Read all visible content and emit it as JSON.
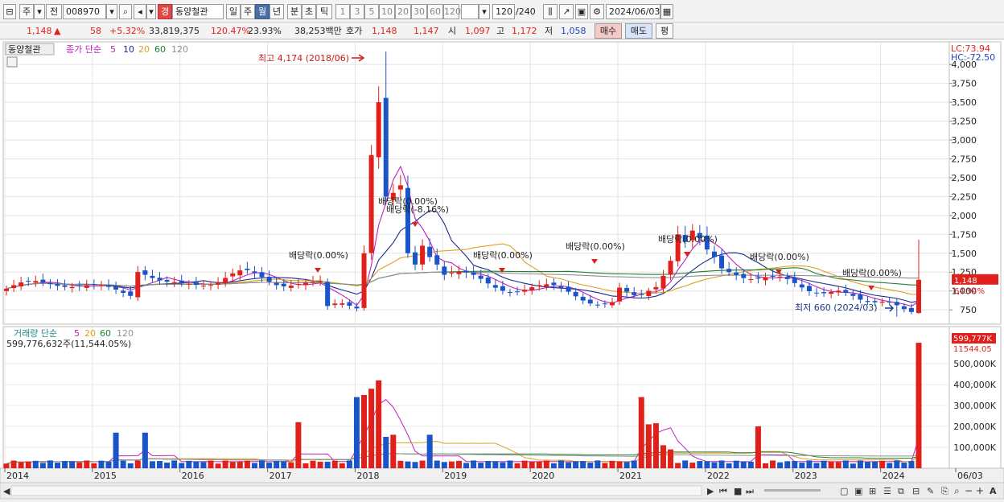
{
  "toolbar": {
    "period_unit": "주",
    "prefix": "전",
    "code": "008970",
    "market_badge": "경",
    "stock_name": "동양철관",
    "period_buttons": [
      "일",
      "주",
      "월",
      "년",
      "분",
      "초",
      "틱"
    ],
    "selected_period": "월",
    "interval_buttons": [
      "1",
      "3",
      "5",
      "10",
      "20",
      "30",
      "60",
      "120"
    ],
    "range_current": "120",
    "range_total": "/240",
    "date": "2024/06/03"
  },
  "quote": {
    "price": "1,148",
    "direction": "▲",
    "change": "58",
    "change_pct": "+5.32%",
    "volume": "33,819,375",
    "volume_ratio": "120.47%",
    "turnover": "23.93%",
    "amount": "38,253백만",
    "ask_label": "호가",
    "ask": "1,148",
    "bid": "1,147",
    "open_label": "시",
    "open": "1,097",
    "high_label": "고",
    "high": "1,172",
    "low_label": "저",
    "low": "1,058",
    "buy_label": "매수",
    "sell_label": "매도",
    "avg_label": "평"
  },
  "price_legend": {
    "name": "동양철관",
    "ma_label": "종가 단순",
    "periods": [
      "5",
      "10",
      "20",
      "60",
      "120"
    ],
    "lc": "LC:73.94",
    "hc": "HC:-72.50",
    "current_tag": "1,148",
    "current_pct": "64.94%"
  },
  "volume_legend": {
    "label": "거래량 단순",
    "periods": [
      "5",
      "20",
      "60",
      "120"
    ],
    "current": "599,776,632주(11,544.05%)",
    "tag": "599,777K",
    "tag_pct": "11544.05"
  },
  "colors": {
    "up": "#e0201a",
    "down": "#1a55c8",
    "ma5": "#c020c0",
    "ma10": "#1a2a90",
    "ma20": "#e0a020",
    "ma60": "#208030",
    "ma120": "#909090"
  },
  "chart_data": [
    {
      "type": "candlestick",
      "title": "동양철관",
      "x_axis_labels": [
        "2014",
        "2015",
        "2016",
        "2017",
        "2018",
        "2019",
        "2020",
        "2021",
        "2022",
        "2023",
        "2024",
        "06/03"
      ],
      "y_ticks": [
        750,
        1000,
        1250,
        1500,
        1750,
        2000,
        2250,
        2500,
        2750,
        3000,
        3250,
        3500,
        3750,
        4000
      ],
      "ylim": [
        560,
        4300
      ],
      "annotations": [
        {
          "text": "최고 4,174 (2018/06)",
          "value": 4174
        },
        {
          "text": "최저 660 (2024/03)",
          "value": 660
        },
        {
          "text": "배당락(0.00%)"
        },
        {
          "text": "배당락(0.00%)"
        },
        {
          "text": "배당락(0.00%)"
        },
        {
          "text": "배당락(0.00%)"
        },
        {
          "text": "배당락(0.00%)"
        },
        {
          "text": "배당락(0.00%)"
        },
        {
          "text": "배당락(0.00%)"
        },
        {
          "text": "배당락(-8.16%)"
        }
      ],
      "last_candle": {
        "open": 1097,
        "high": 1172,
        "low": 1058,
        "close": 1148
      }
    },
    {
      "type": "bar",
      "title": "거래량",
      "y_ticks": [
        "100,000K",
        "200,000K",
        "300,000K",
        "400,000K",
        "500,000K"
      ],
      "ylim": [
        0,
        600000
      ],
      "last_value": 599777
    }
  ]
}
